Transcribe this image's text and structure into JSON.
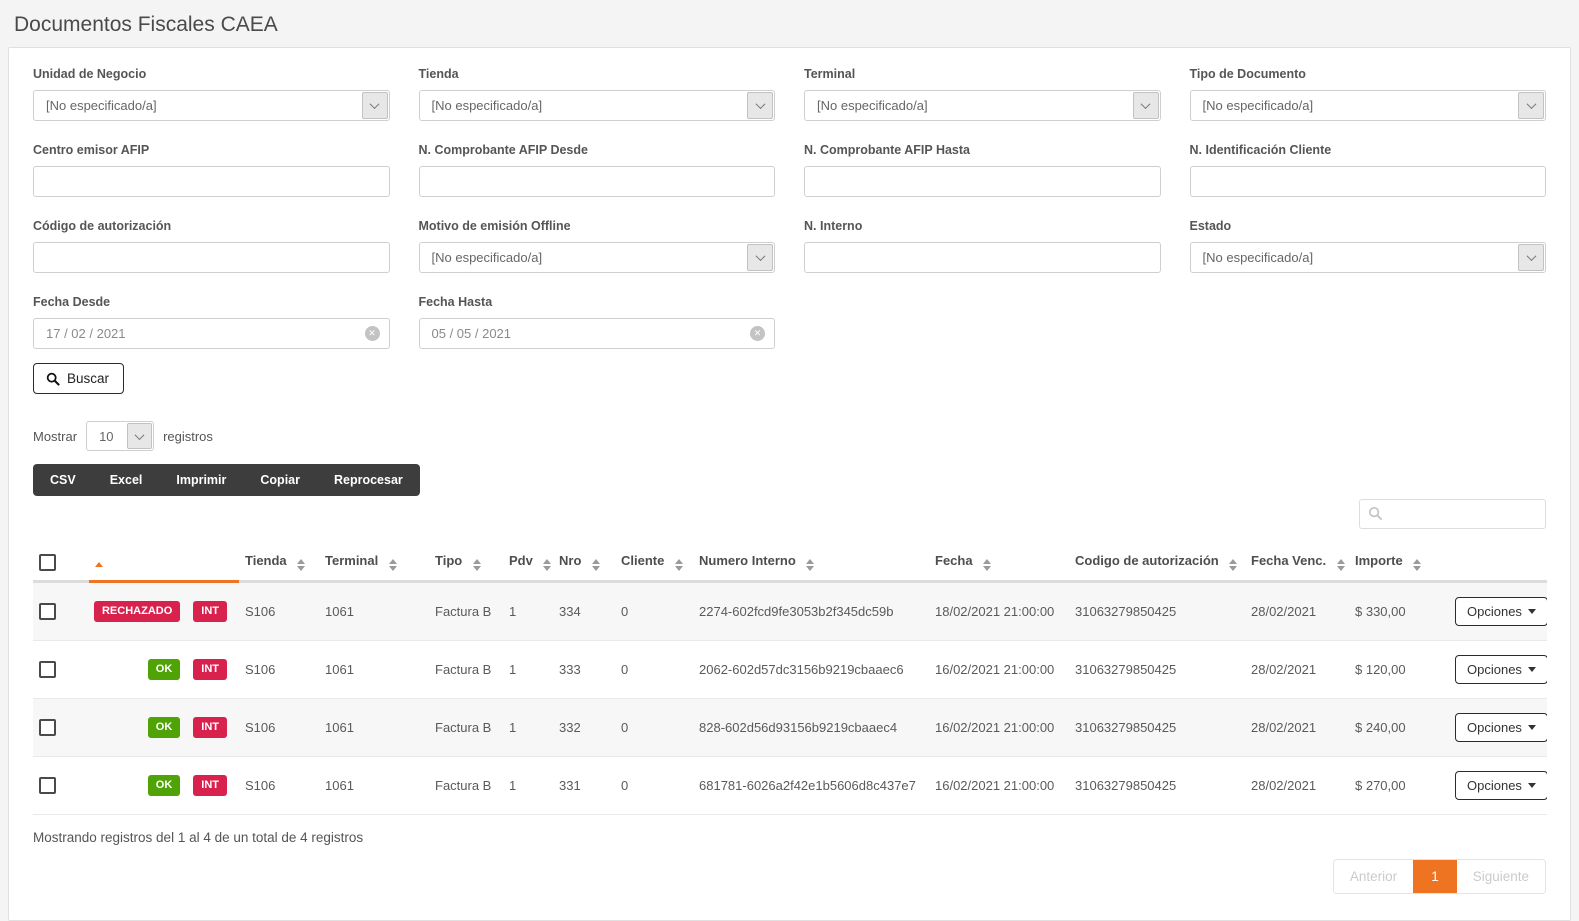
{
  "page": {
    "title": "Documentos Fiscales CAEA"
  },
  "colors": {
    "accent_orange": "#ef7421",
    "badge_red": "#d9214e",
    "badge_green": "#4fa306",
    "toolbar_dark": "#3d3d3d"
  },
  "filters": {
    "fields": [
      {
        "label": "Unidad de Negocio",
        "type": "select",
        "value": "[No especificado/a]"
      },
      {
        "label": "Tienda",
        "type": "select",
        "value": "[No especificado/a]"
      },
      {
        "label": "Terminal",
        "type": "select",
        "value": "[No especificado/a]"
      },
      {
        "label": "Tipo de Documento",
        "type": "select",
        "value": "[No especificado/a]"
      },
      {
        "label": "Centro emisor AFIP",
        "type": "text",
        "value": ""
      },
      {
        "label": "N. Comprobante AFIP Desde",
        "type": "text",
        "value": ""
      },
      {
        "label": "N. Comprobante AFIP Hasta",
        "type": "text",
        "value": ""
      },
      {
        "label": "N. Identificación Cliente",
        "type": "text",
        "value": ""
      },
      {
        "label": "Código de autorización",
        "type": "text",
        "value": ""
      },
      {
        "label": "Motivo de emisión Offline",
        "type": "select",
        "value": "[No especificado/a]"
      },
      {
        "label": "N. Interno",
        "type": "text",
        "value": ""
      },
      {
        "label": "Estado",
        "type": "select",
        "value": "[No especificado/a]"
      },
      {
        "label": "Fecha Desde",
        "type": "date",
        "value": "17 / 02 / 2021"
      },
      {
        "label": "Fecha Hasta",
        "type": "date",
        "value": "05 / 05 / 2021"
      }
    ],
    "search_button": "Buscar"
  },
  "length_control": {
    "prefix": "Mostrar",
    "value": "10",
    "suffix": "registros"
  },
  "export_buttons": {
    "csv": "CSV",
    "excel": "Excel",
    "imprimir": "Imprimir",
    "copiar": "Copiar",
    "reprocesar": "Reprocesar"
  },
  "table": {
    "columns": {
      "tienda": "Tienda",
      "terminal": "Terminal",
      "tipo": "Tipo",
      "pdv": "Pdv",
      "nro": "Nro",
      "cliente": "Cliente",
      "numero_interno": "Numero Interno",
      "fecha": "Fecha",
      "codigo": "Codigo de autorización",
      "fecha_venc": "Fecha Venc.",
      "importe": "Importe"
    },
    "rows": [
      {
        "status": "RECHAZADO",
        "origin": "INT",
        "tienda": "S106",
        "terminal": "1061",
        "tipo": "Factura B",
        "pdv": "1",
        "nro": "334",
        "cliente": "0",
        "numero_interno": "2274-602fcd9fe3053b2f345dc59b",
        "fecha": "18/02/2021 21:00:00",
        "codigo": "31063279850425",
        "fecha_venc": "28/02/2021",
        "importe": "$ 330,00",
        "opciones": "Opciones"
      },
      {
        "status": "OK",
        "origin": "INT",
        "tienda": "S106",
        "terminal": "1061",
        "tipo": "Factura B",
        "pdv": "1",
        "nro": "333",
        "cliente": "0",
        "numero_interno": "2062-602d57dc3156b9219cbaaec6",
        "fecha": "16/02/2021 21:00:00",
        "codigo": "31063279850425",
        "fecha_venc": "28/02/2021",
        "importe": "$ 120,00",
        "opciones": "Opciones"
      },
      {
        "status": "OK",
        "origin": "INT",
        "tienda": "S106",
        "terminal": "1061",
        "tipo": "Factura B",
        "pdv": "1",
        "nro": "332",
        "cliente": "0",
        "numero_interno": "828-602d56d93156b9219cbaaec4",
        "fecha": "16/02/2021 21:00:00",
        "codigo": "31063279850425",
        "fecha_venc": "28/02/2021",
        "importe": "$ 240,00",
        "opciones": "Opciones"
      },
      {
        "status": "OK",
        "origin": "INT",
        "tienda": "S106",
        "terminal": "1061",
        "tipo": "Factura B",
        "pdv": "1",
        "nro": "331",
        "cliente": "0",
        "numero_interno": "681781-6026a2f42e1b5606d8c437e7",
        "fecha": "16/02/2021 21:00:00",
        "codigo": "31063279850425",
        "fecha_venc": "28/02/2021",
        "importe": "$ 270,00",
        "opciones": "Opciones"
      }
    ],
    "footer_info": "Mostrando registros del 1 al 4 de un total de 4 registros"
  },
  "pagination": {
    "prev": "Anterior",
    "page": "1",
    "next": "Siguiente"
  }
}
